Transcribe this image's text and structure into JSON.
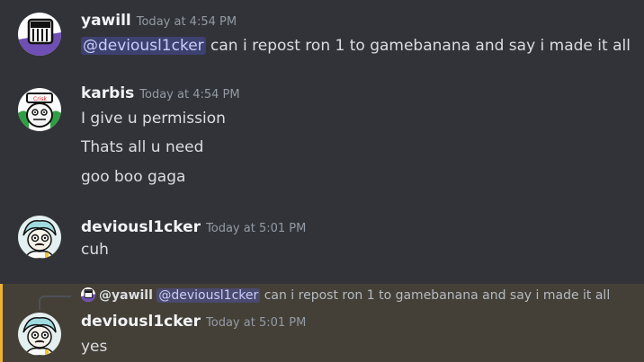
{
  "messages": [
    {
      "username": "yawill",
      "timestamp": "Today at 4:54 PM",
      "mention": "@deviousl1cker",
      "text": " can i repost ron 1 to gamebanana and say i made it all"
    },
    {
      "username": "karbis",
      "timestamp": "Today at 4:54 PM",
      "lines": [
        "I give u permission",
        "Thats all u need",
        "goo boo gaga"
      ]
    },
    {
      "username": "deviousl1cker",
      "timestamp": "Today at 5:01 PM",
      "text": "cuh"
    },
    {
      "reply": {
        "username": "@yawill",
        "mention": "@deviousl1cker",
        "text": " can i repost ron 1 to gamebanana and say i made it all"
      },
      "username": "deviousl1cker",
      "timestamp": "Today at 5:01 PM",
      "text": "yes"
    }
  ],
  "colors": {
    "background": "#313338",
    "highlight": "#444037",
    "highlight_bar": "#f0b232",
    "mention_bg": "#3c4270",
    "mention_fg": "#c9cdfb"
  }
}
